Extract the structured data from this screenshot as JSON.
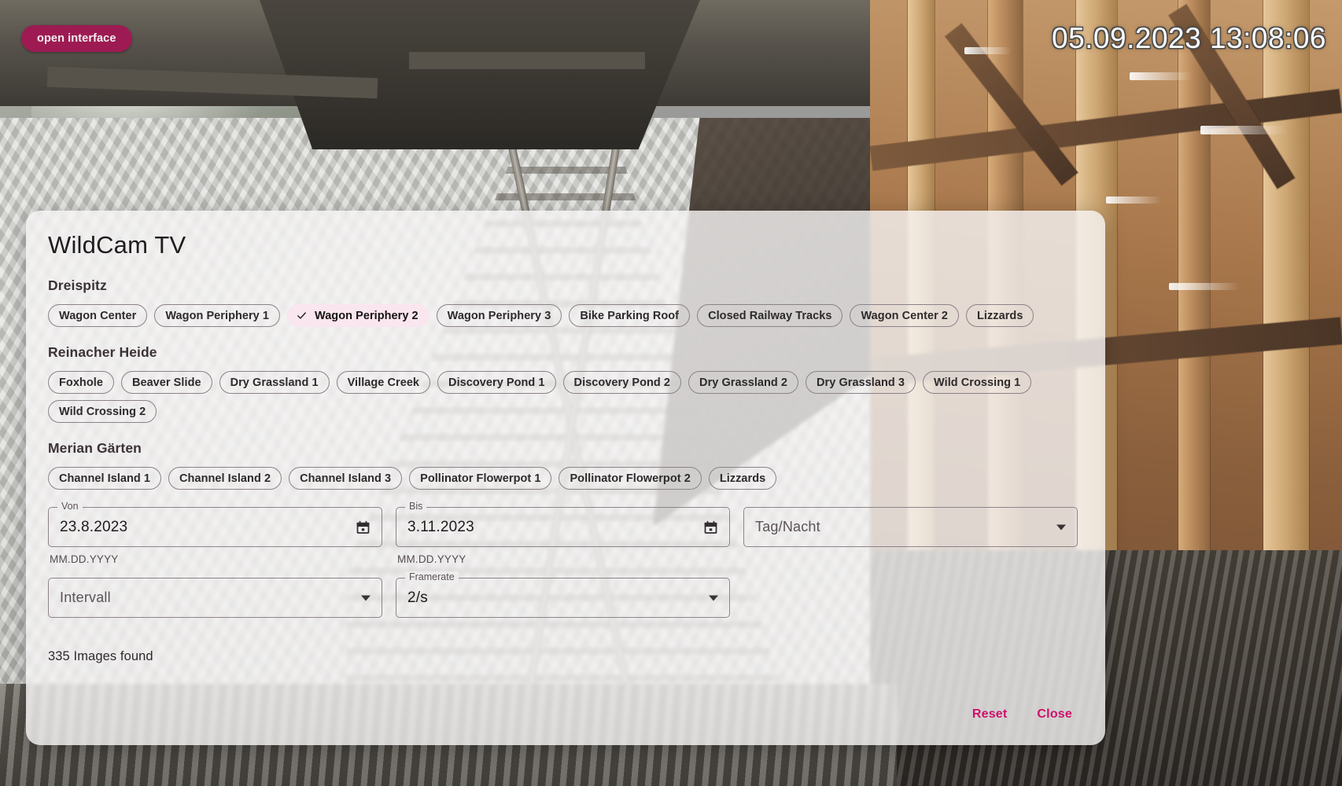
{
  "video": {
    "open_interface_label": "open interface",
    "timestamp": "05.09.2023 13:08:06"
  },
  "dialog": {
    "title": "WildCam TV",
    "groups": [
      {
        "heading": "Dreispitz",
        "chips": [
          {
            "label": "Wagon Center",
            "selected": false
          },
          {
            "label": "Wagon Periphery 1",
            "selected": false
          },
          {
            "label": "Wagon Periphery 2",
            "selected": true
          },
          {
            "label": "Wagon Periphery 3",
            "selected": false
          },
          {
            "label": "Bike Parking Roof",
            "selected": false
          },
          {
            "label": "Closed Railway Tracks",
            "selected": false
          },
          {
            "label": "Wagon Center 2",
            "selected": false
          },
          {
            "label": "Lizzards",
            "selected": false
          }
        ]
      },
      {
        "heading": "Reinacher Heide",
        "chips": [
          {
            "label": "Foxhole",
            "selected": false
          },
          {
            "label": "Beaver Slide",
            "selected": false
          },
          {
            "label": "Dry Grassland 1",
            "selected": false
          },
          {
            "label": "Village Creek",
            "selected": false
          },
          {
            "label": "Discovery Pond 1",
            "selected": false
          },
          {
            "label": "Discovery Pond 2",
            "selected": false
          },
          {
            "label": "Dry Grassland 2",
            "selected": false
          },
          {
            "label": "Dry Grassland 3",
            "selected": false
          },
          {
            "label": "Wild Crossing 1",
            "selected": false
          },
          {
            "label": "Wild Crossing 2",
            "selected": false
          }
        ]
      },
      {
        "heading": "Merian Gärten",
        "chips": [
          {
            "label": "Channel Island 1",
            "selected": false
          },
          {
            "label": "Channel Island 2",
            "selected": false
          },
          {
            "label": "Channel Island 3",
            "selected": false
          },
          {
            "label": "Pollinator Flowerpot 1",
            "selected": false
          },
          {
            "label": "Pollinator Flowerpot 2",
            "selected": false
          },
          {
            "label": "Lizzards",
            "selected": false
          }
        ]
      }
    ],
    "fields": {
      "from": {
        "label": "Von",
        "value": "23.8.2023",
        "hint": "MM.DD.YYYY",
        "icon": "calendar-icon"
      },
      "to": {
        "label": "Bis",
        "value": "3.11.2023",
        "hint": "MM.DD.YYYY",
        "icon": "calendar-icon"
      },
      "daynight": {
        "placeholder": "Tag/Nacht",
        "value": "",
        "icon": "chevron-down-icon"
      },
      "interval": {
        "placeholder": "Intervall",
        "value": "",
        "icon": "chevron-down-icon"
      },
      "framerate": {
        "label": "Framerate",
        "value": "2/s",
        "icon": "chevron-down-icon"
      }
    },
    "result_count": "335 Images found",
    "actions": {
      "reset_label": "Reset",
      "close_label": "Close"
    }
  },
  "colors": {
    "accent": "#cf0f6b",
    "brand_button": "#9d1b52",
    "chip_selected_bg": "#fae6ee",
    "chip_border": "#8c8288"
  }
}
